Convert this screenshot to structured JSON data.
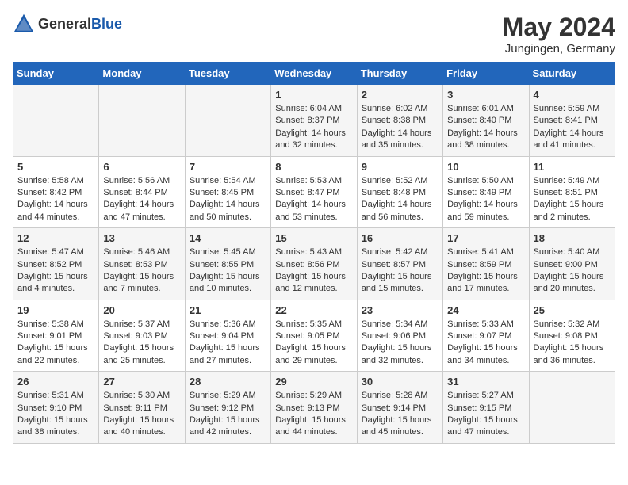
{
  "header": {
    "logo_general": "General",
    "logo_blue": "Blue",
    "month": "May 2024",
    "location": "Jungingen, Germany"
  },
  "days_of_week": [
    "Sunday",
    "Monday",
    "Tuesday",
    "Wednesday",
    "Thursday",
    "Friday",
    "Saturday"
  ],
  "weeks": [
    [
      {
        "day": "",
        "info": ""
      },
      {
        "day": "",
        "info": ""
      },
      {
        "day": "",
        "info": ""
      },
      {
        "day": "1",
        "info": "Sunrise: 6:04 AM\nSunset: 8:37 PM\nDaylight: 14 hours\nand 32 minutes."
      },
      {
        "day": "2",
        "info": "Sunrise: 6:02 AM\nSunset: 8:38 PM\nDaylight: 14 hours\nand 35 minutes."
      },
      {
        "day": "3",
        "info": "Sunrise: 6:01 AM\nSunset: 8:40 PM\nDaylight: 14 hours\nand 38 minutes."
      },
      {
        "day": "4",
        "info": "Sunrise: 5:59 AM\nSunset: 8:41 PM\nDaylight: 14 hours\nand 41 minutes."
      }
    ],
    [
      {
        "day": "5",
        "info": "Sunrise: 5:58 AM\nSunset: 8:42 PM\nDaylight: 14 hours\nand 44 minutes."
      },
      {
        "day": "6",
        "info": "Sunrise: 5:56 AM\nSunset: 8:44 PM\nDaylight: 14 hours\nand 47 minutes."
      },
      {
        "day": "7",
        "info": "Sunrise: 5:54 AM\nSunset: 8:45 PM\nDaylight: 14 hours\nand 50 minutes."
      },
      {
        "day": "8",
        "info": "Sunrise: 5:53 AM\nSunset: 8:47 PM\nDaylight: 14 hours\nand 53 minutes."
      },
      {
        "day": "9",
        "info": "Sunrise: 5:52 AM\nSunset: 8:48 PM\nDaylight: 14 hours\nand 56 minutes."
      },
      {
        "day": "10",
        "info": "Sunrise: 5:50 AM\nSunset: 8:49 PM\nDaylight: 14 hours\nand 59 minutes."
      },
      {
        "day": "11",
        "info": "Sunrise: 5:49 AM\nSunset: 8:51 PM\nDaylight: 15 hours\nand 2 minutes."
      }
    ],
    [
      {
        "day": "12",
        "info": "Sunrise: 5:47 AM\nSunset: 8:52 PM\nDaylight: 15 hours\nand 4 minutes."
      },
      {
        "day": "13",
        "info": "Sunrise: 5:46 AM\nSunset: 8:53 PM\nDaylight: 15 hours\nand 7 minutes."
      },
      {
        "day": "14",
        "info": "Sunrise: 5:45 AM\nSunset: 8:55 PM\nDaylight: 15 hours\nand 10 minutes."
      },
      {
        "day": "15",
        "info": "Sunrise: 5:43 AM\nSunset: 8:56 PM\nDaylight: 15 hours\nand 12 minutes."
      },
      {
        "day": "16",
        "info": "Sunrise: 5:42 AM\nSunset: 8:57 PM\nDaylight: 15 hours\nand 15 minutes."
      },
      {
        "day": "17",
        "info": "Sunrise: 5:41 AM\nSunset: 8:59 PM\nDaylight: 15 hours\nand 17 minutes."
      },
      {
        "day": "18",
        "info": "Sunrise: 5:40 AM\nSunset: 9:00 PM\nDaylight: 15 hours\nand 20 minutes."
      }
    ],
    [
      {
        "day": "19",
        "info": "Sunrise: 5:38 AM\nSunset: 9:01 PM\nDaylight: 15 hours\nand 22 minutes."
      },
      {
        "day": "20",
        "info": "Sunrise: 5:37 AM\nSunset: 9:03 PM\nDaylight: 15 hours\nand 25 minutes."
      },
      {
        "day": "21",
        "info": "Sunrise: 5:36 AM\nSunset: 9:04 PM\nDaylight: 15 hours\nand 27 minutes."
      },
      {
        "day": "22",
        "info": "Sunrise: 5:35 AM\nSunset: 9:05 PM\nDaylight: 15 hours\nand 29 minutes."
      },
      {
        "day": "23",
        "info": "Sunrise: 5:34 AM\nSunset: 9:06 PM\nDaylight: 15 hours\nand 32 minutes."
      },
      {
        "day": "24",
        "info": "Sunrise: 5:33 AM\nSunset: 9:07 PM\nDaylight: 15 hours\nand 34 minutes."
      },
      {
        "day": "25",
        "info": "Sunrise: 5:32 AM\nSunset: 9:08 PM\nDaylight: 15 hours\nand 36 minutes."
      }
    ],
    [
      {
        "day": "26",
        "info": "Sunrise: 5:31 AM\nSunset: 9:10 PM\nDaylight: 15 hours\nand 38 minutes."
      },
      {
        "day": "27",
        "info": "Sunrise: 5:30 AM\nSunset: 9:11 PM\nDaylight: 15 hours\nand 40 minutes."
      },
      {
        "day": "28",
        "info": "Sunrise: 5:29 AM\nSunset: 9:12 PM\nDaylight: 15 hours\nand 42 minutes."
      },
      {
        "day": "29",
        "info": "Sunrise: 5:29 AM\nSunset: 9:13 PM\nDaylight: 15 hours\nand 44 minutes."
      },
      {
        "day": "30",
        "info": "Sunrise: 5:28 AM\nSunset: 9:14 PM\nDaylight: 15 hours\nand 45 minutes."
      },
      {
        "day": "31",
        "info": "Sunrise: 5:27 AM\nSunset: 9:15 PM\nDaylight: 15 hours\nand 47 minutes."
      },
      {
        "day": "",
        "info": ""
      }
    ]
  ]
}
